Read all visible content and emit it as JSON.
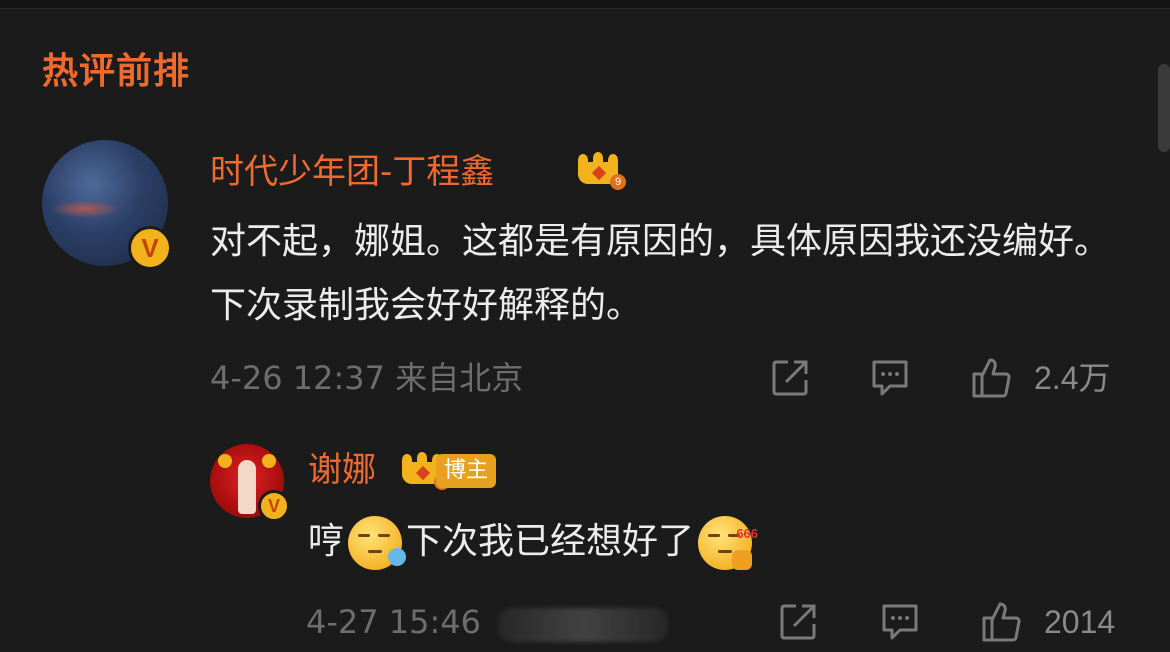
{
  "section": {
    "title": "热评前排"
  },
  "comment": {
    "username": "时代少年团-丁程鑫",
    "crown_level": "9",
    "text": "对不起，娜姐。这都是有原因的，具体原因我还没编好。下次录制我会好好解释的。",
    "meta": "4-26 12:37 来自北京",
    "likes": "2.4万"
  },
  "reply": {
    "username": "谢娜",
    "crown_level": "7",
    "blogger_tag": "博主",
    "text_before": "哼",
    "text_middle": "下次我已经想好了",
    "emoji_tag": "666",
    "meta": "4-27 15:46",
    "likes": "2014"
  },
  "icons": {
    "share": "share-icon",
    "comment": "comment-icon",
    "like": "thumbs-up-icon",
    "verified": "verified-v-icon",
    "crown": "crown-icon"
  },
  "colors": {
    "accent": "#f06a2f",
    "background": "#1b1b1b",
    "meta": "#6d6d6d",
    "badge": "#f2b21c"
  }
}
